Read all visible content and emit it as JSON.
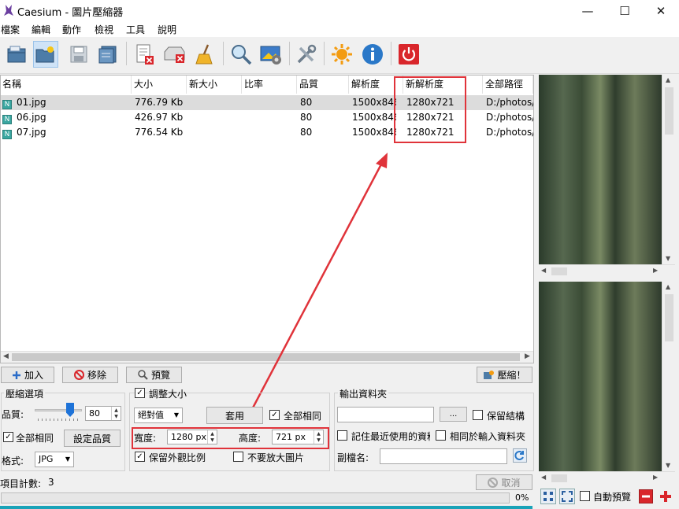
{
  "window": {
    "title": "Caesium - 圖片壓縮器",
    "minimize_glyph": "—",
    "maximize_glyph": "☐",
    "close_glyph": "✕"
  },
  "menu": [
    "檔案",
    "編輯",
    "動作",
    "檢視",
    "工具",
    "說明"
  ],
  "toolbar_icons": [
    "open-file-icon",
    "open-folder-icon",
    "save-icon",
    "save-list-icon",
    "remove-item-icon",
    "remove-all-icon",
    "clear-list-icon",
    "search-icon",
    "preview-icon",
    "settings-icon",
    "sun-icon",
    "info-icon",
    "power-icon"
  ],
  "list": {
    "columns": [
      "名稱",
      "大小",
      "新大小",
      "比率",
      "品質",
      "解析度",
      "新解析度",
      "全部路徑"
    ],
    "badge": "N",
    "rows": [
      {
        "name": "01.jpg",
        "size": "776.79 Kb",
        "new_size": "",
        "ratio": "",
        "quality": "80",
        "resolution": "1500x846",
        "new_resolution": "1280x721",
        "path": "D:/photos/"
      },
      {
        "name": "06.jpg",
        "size": "426.97 Kb",
        "new_size": "",
        "ratio": "",
        "quality": "80",
        "resolution": "1500x846",
        "new_resolution": "1280x721",
        "path": "D:/photos/"
      },
      {
        "name": "07.jpg",
        "size": "776.54 Kb",
        "new_size": "",
        "ratio": "",
        "quality": "80",
        "resolution": "1500x846",
        "new_resolution": "1280x721",
        "path": "D:/photos/"
      }
    ]
  },
  "actions": {
    "add": "加入",
    "remove": "移除",
    "preview": "預覽",
    "compress": "壓縮！"
  },
  "compression": {
    "legend": "壓縮選項",
    "quality_label": "品質:",
    "quality_value": "80",
    "quality_level": 0.8,
    "same_all_label": "全部相同",
    "set_quality_button": "設定品質",
    "format_label": "格式:",
    "format_value": "JPG"
  },
  "resize": {
    "resize_label": "調整大小",
    "mode_value": "絕對值",
    "apply_button": "套用",
    "same_all_label": "全部相同",
    "width_label": "寬度:",
    "width_value": "1280 px",
    "height_label": "高度:",
    "height_value": "721 px",
    "keep_ratio_label": "保留外觀比例",
    "no_enlarge_label": "不要放大圖片"
  },
  "output": {
    "legend": "輸出資料夾",
    "folder_value": "",
    "browse_button": "...",
    "keep_structure_label": "保留結構",
    "remember_label": "記住最近使用的資料",
    "same_as_input_label": "相同於輸入資料夾",
    "suffix_label": "副檔名:",
    "suffix_value": ""
  },
  "status": {
    "item_count_label": "項目計數:",
    "item_count": "3",
    "cancel_button": "取消",
    "progress_text": "0%",
    "progress": 0
  },
  "preview_panel": {
    "auto_preview_label": "自動預覽"
  },
  "colors": {
    "highlight_red": "#e0333a",
    "selected_row": "#dcdcdc",
    "toolbar_selected": "#cfe3f7"
  }
}
